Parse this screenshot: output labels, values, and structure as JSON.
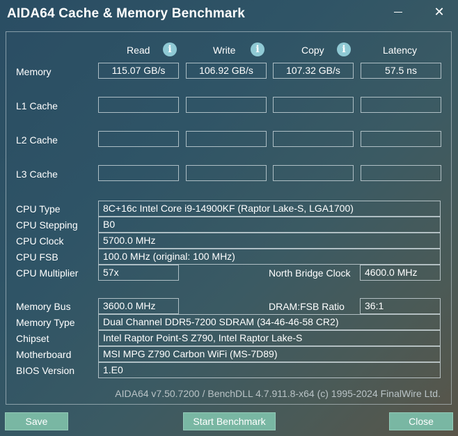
{
  "window": {
    "title": "AIDA64 Cache & Memory Benchmark"
  },
  "columns": {
    "read": "Read",
    "write": "Write",
    "copy": "Copy",
    "latency": "Latency"
  },
  "rows": {
    "memory": {
      "label": "Memory",
      "read": "115.07 GB/s",
      "write": "106.92 GB/s",
      "copy": "107.32 GB/s",
      "latency": "57.5 ns"
    },
    "l1": {
      "label": "L1 Cache",
      "read": "",
      "write": "",
      "copy": "",
      "latency": ""
    },
    "l2": {
      "label": "L2 Cache",
      "read": "",
      "write": "",
      "copy": "",
      "latency": ""
    },
    "l3": {
      "label": "L3 Cache",
      "read": "",
      "write": "",
      "copy": "",
      "latency": ""
    }
  },
  "cpu": {
    "type_label": "CPU Type",
    "type": "8C+16c Intel Core i9-14900KF  (Raptor Lake-S, LGA1700)",
    "stepping_label": "CPU Stepping",
    "stepping": "B0",
    "clock_label": "CPU Clock",
    "clock": "5700.0 MHz",
    "fsb_label": "CPU FSB",
    "fsb": "100.0 MHz  (original: 100 MHz)",
    "multiplier_label": "CPU Multiplier",
    "multiplier": "57x",
    "nb_clock_label": "North Bridge Clock",
    "nb_clock": "4600.0 MHz"
  },
  "memory": {
    "bus_label": "Memory Bus",
    "bus": "3600.0 MHz",
    "ratio_label": "DRAM:FSB Ratio",
    "ratio": "36:1",
    "type_label": "Memory Type",
    "type": "Dual Channel DDR5-7200 SDRAM  (34-46-46-58 CR2)",
    "chipset_label": "Chipset",
    "chipset": "Intel Raptor Point-S Z790, Intel Raptor Lake-S",
    "motherboard_label": "Motherboard",
    "motherboard": "MSI MPG Z790 Carbon WiFi (MS-7D89)",
    "bios_label": "BIOS Version",
    "bios": "1.E0"
  },
  "footer": "AIDA64 v7.50.7200 / BenchDLL 4.7.911.8-x64  (c) 1995-2024 FinalWire Ltd.",
  "buttons": {
    "save": "Save",
    "start": "Start Benchmark",
    "close": "Close"
  },
  "icons": {
    "info": "info-icon",
    "minimize": "minimize-icon",
    "close": "close-icon"
  },
  "colors": {
    "button": "#79b7a3",
    "info_icon": "#8fc9d4"
  }
}
